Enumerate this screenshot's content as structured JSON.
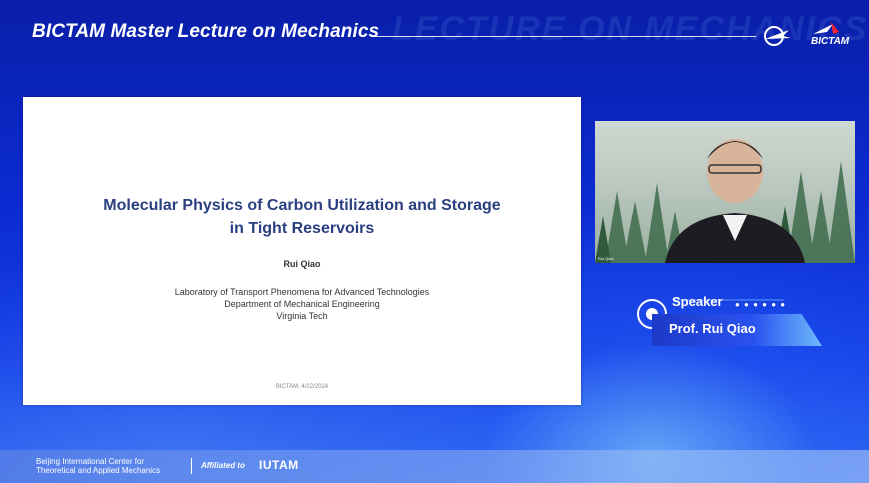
{
  "header": {
    "title": "BICTAM Master Lecture on Mechanics",
    "logo2_text": "BICTAM"
  },
  "slide": {
    "title_line1": "Molecular Physics of Carbon Utilization and Storage",
    "title_line2": "in Tight Reservoirs",
    "author": "Rui Qiao",
    "affiliation_line1": "Laboratory of Transport Phenomena for Advanced Technologies",
    "affiliation_line2": "Department of Mechanical Engineering",
    "affiliation_line3": "Virginia Tech",
    "footer": "BICTAM, 4/22/2024"
  },
  "video": {
    "participant_label": "Rui Qiao"
  },
  "speaker": {
    "label": "Speaker",
    "name": "Prof. Rui Qiao"
  },
  "footer": {
    "institution_line1": "Beijing International Center for",
    "institution_line2": "Theoretical and Applied Mechanics",
    "affiliated_label": "Affiliated to",
    "affiliated_org": "IUTAM"
  }
}
